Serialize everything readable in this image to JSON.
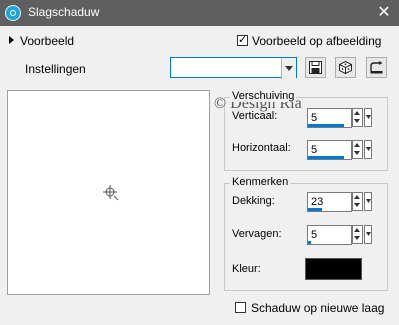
{
  "window": {
    "title": "Slagschaduw",
    "close_glyph": "✕",
    "app_icon": "app-icon"
  },
  "preview_toggle": {
    "label": "Voorbeeld",
    "expanded": false
  },
  "preview_on_image": {
    "label": "Voorbeeld op afbeelding",
    "checked": true
  },
  "settings": {
    "label": "Instellingen",
    "value": ""
  },
  "toolbar_icons": [
    "save-icon",
    "cube-icon",
    "reset-icon"
  ],
  "watermark": "© Design Ria",
  "offset_group": {
    "title": "Verschuiving",
    "vertical": {
      "label": "Verticaal:",
      "value": "5",
      "level": 5
    },
    "horizontal": {
      "label": "Horizontaal:",
      "value": "5",
      "level": 5
    }
  },
  "properties_group": {
    "title": "Kenmerken",
    "opacity": {
      "label": "Dekking:",
      "value": "23",
      "level": 23
    },
    "blur": {
      "label": "Vervagen:",
      "value": "5",
      "level": 5
    },
    "color": {
      "label": "Kleur:",
      "value": "#000000"
    }
  },
  "new_layer": {
    "label": "Schaduw op nieuwe laag",
    "checked": false
  }
}
